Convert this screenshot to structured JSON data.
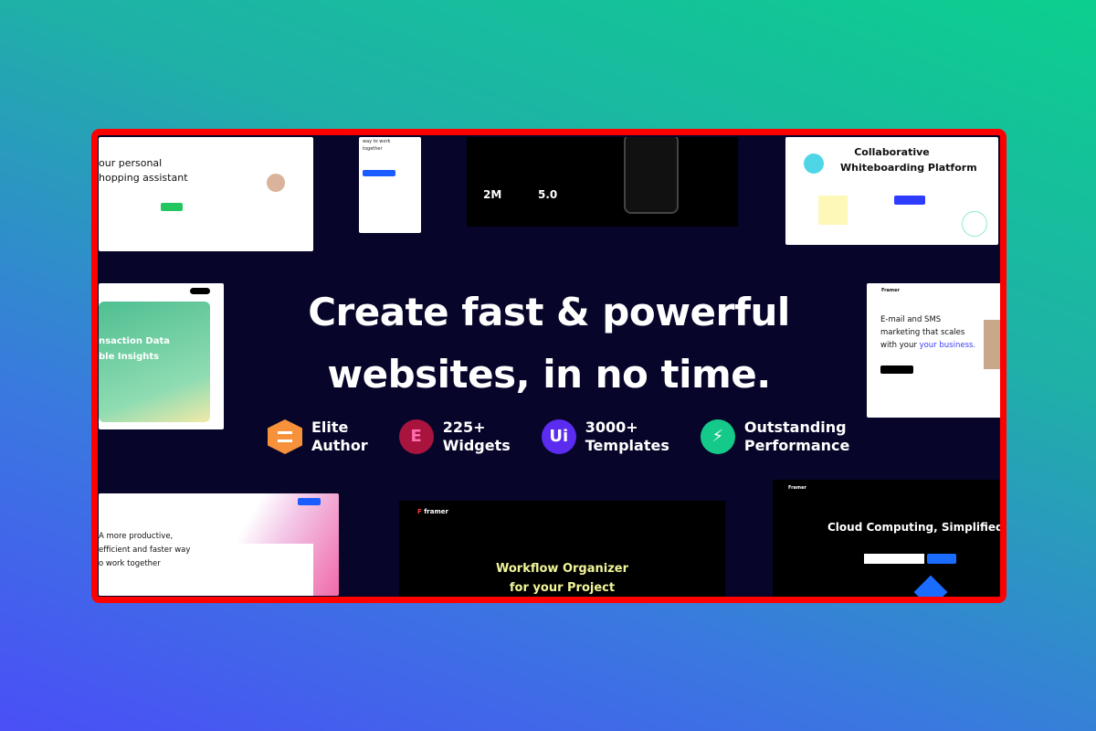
{
  "headline": {
    "line1": "Create fast & powerful",
    "line2": "websites, in no time."
  },
  "features": [
    {
      "icon": "elite-author-badge-icon",
      "color": "#f7923a",
      "line1": "Elite",
      "line2": "Author"
    },
    {
      "icon": "elementor-icon",
      "color": "#a8143e",
      "glyph": "E",
      "line1": "225+",
      "line2": "Widgets"
    },
    {
      "icon": "ui-icon",
      "color": "#5b2bf0",
      "glyph": "Ui",
      "line1": "3000+",
      "line2": "Templates"
    },
    {
      "icon": "lightning-icon",
      "color": "#14c98a",
      "glyph": "⚡",
      "line1": "Outstanding",
      "line2": "Performance"
    }
  ],
  "thumbnails": {
    "shopping": {
      "title1": "our personal",
      "title2": "hopping assistant"
    },
    "together": {
      "title1": "way to work",
      "title2": "together"
    },
    "app": {
      "stat1": "2M",
      "stat2": "5.0"
    },
    "whiteboard": {
      "title1": "Collaborative",
      "title2": "Whiteboarding Platform"
    },
    "transaction": {
      "title1": "nsaction Data",
      "title2": "ble Insights"
    },
    "email": {
      "brand": "Framer",
      "title1": "E-mail and SMS",
      "title2": "marketing that scales",
      "title3": "with your",
      "title3_accent": "your business."
    },
    "productive": {
      "title1": "A more productive,",
      "title2": "efficient and faster way",
      "title3": "o work together"
    },
    "workflow": {
      "brand": "framer",
      "title1": "Workflow Organizer",
      "title2": "for your Project"
    },
    "cloud": {
      "brand": "Framer",
      "title": "Cloud Computing, Simplified"
    }
  },
  "colors": {
    "frame_border": "#ff0000",
    "frame_bg": "#07062a",
    "accent_blue": "#2d5bff",
    "accent_green": "#22c55e"
  }
}
